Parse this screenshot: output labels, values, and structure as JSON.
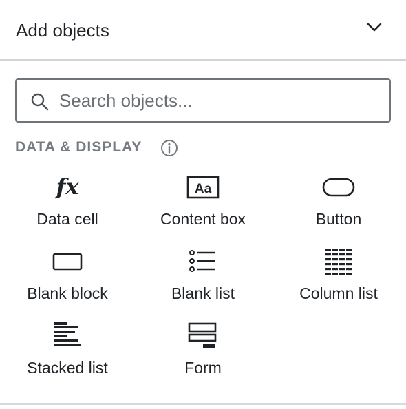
{
  "header": {
    "title": "Add objects"
  },
  "search": {
    "placeholder": "Search objects..."
  },
  "section": {
    "label": "DATA & DISPLAY"
  },
  "tiles": [
    {
      "label": "Data cell",
      "icon": "function-icon"
    },
    {
      "label": "Content box",
      "icon": "text-box-icon"
    },
    {
      "label": "Button",
      "icon": "button-shape-icon"
    },
    {
      "label": "Blank block",
      "icon": "rectangle-icon"
    },
    {
      "label": "Blank list",
      "icon": "bulleted-list-icon"
    },
    {
      "label": "Column list",
      "icon": "column-grid-icon"
    },
    {
      "label": "Stacked list",
      "icon": "stacked-lines-icon"
    },
    {
      "label": "Form",
      "icon": "form-icon"
    }
  ],
  "colors": {
    "text": "#1f2328",
    "muted": "#767b82",
    "border": "#6f747a",
    "divider": "#d0d3d8"
  }
}
